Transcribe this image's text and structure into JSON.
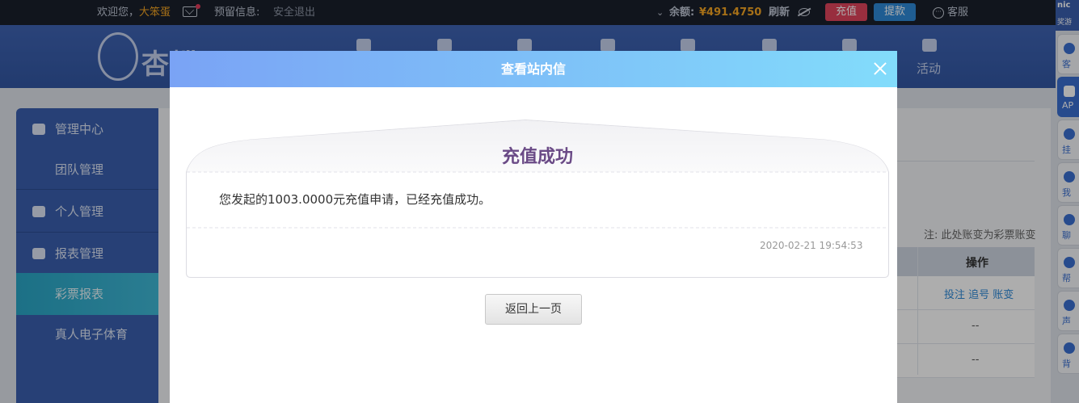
{
  "topbar": {
    "welcome": "欢迎您，",
    "username": "大笨蛋",
    "reserve_info": "预留信息:",
    "logout": "安全退出",
    "balance_label": "余额:",
    "balance_amount": "¥491.4750",
    "refresh": "刷新",
    "recharge": "充值",
    "withdraw": "提款",
    "customer_service": "客服"
  },
  "header": {
    "logo_text": "杏蝶",
    "nav_last_label": "活动"
  },
  "sidebar": {
    "items": [
      {
        "label": "管理中心"
      },
      {
        "label": "团队管理"
      },
      {
        "label": "个人管理"
      },
      {
        "label": "报表管理"
      },
      {
        "label": "彩票报表"
      },
      {
        "label": "真人电子体育"
      }
    ]
  },
  "panel": {
    "note": "注: 此处账变为彩票账变",
    "table_header": "操作",
    "row_actions": "投注 追号 账变",
    "row_dash": "--"
  },
  "right_toolbar": {
    "top": "nic",
    "top_sub": "奖游",
    "items": [
      {
        "label": "客"
      },
      {
        "label": "AP"
      },
      {
        "label": "挂"
      },
      {
        "label": "我"
      },
      {
        "label": "聊"
      },
      {
        "label": "帮"
      },
      {
        "label": "声"
      },
      {
        "label": "背"
      }
    ]
  },
  "modal": {
    "title": "查看站内信",
    "letter_title": "充值成功",
    "letter_body": "您发起的1003.0000元充值申请，已经充值成功。",
    "letter_date": "2020-02-21 19:54:53",
    "back_button": "返回上一页"
  },
  "colors": {
    "accent_blue": "#3a5fae",
    "recharge_red": "#e0455c",
    "withdraw_blue": "#2f8ad8",
    "balance_gold": "#f5a623",
    "letter_title_purple": "#6a4a86"
  }
}
